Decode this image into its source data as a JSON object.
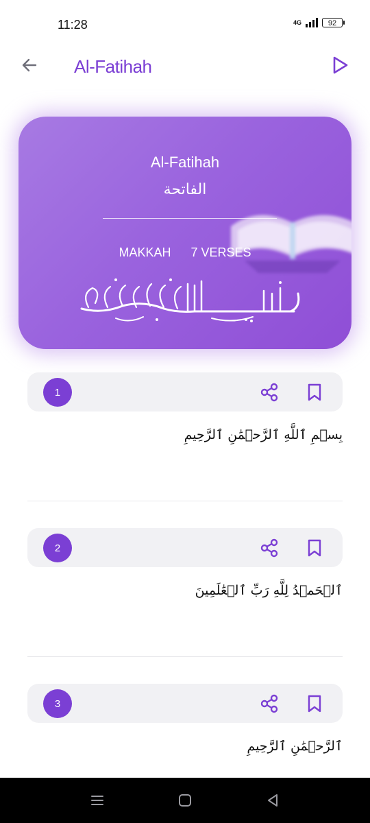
{
  "status_bar": {
    "time": "11:28",
    "network": "4G",
    "battery": "92"
  },
  "app_bar": {
    "title": "Al-Fatihah"
  },
  "surah": {
    "name": "Al-Fatihah",
    "name_arabic": "الفاتحة",
    "revelation": "MAKKAH",
    "verses_label": "7 VERSES"
  },
  "verses": [
    {
      "number": "1",
      "arabic": "بِسۡمِ ٱللَّهِ ٱلرَّحۡمَٰنِ ٱلرَّحِيمِ"
    },
    {
      "number": "2",
      "arabic": "ٱلۡحَمۡدُ لِلَّهِ رَبِّ ٱلۡعَٰلَمِينَ"
    },
    {
      "number": "3",
      "arabic": "ٱلرَّحۡمَٰنِ ٱلرَّحِيمِ"
    }
  ],
  "colors": {
    "accent": "#7b3fd4",
    "card_start": "#a77ae3",
    "card_end": "#8f4ed6",
    "verse_bar": "#f1f1f4"
  },
  "icons": {
    "back": "arrow-left-icon",
    "play": "play-icon",
    "share": "share-icon",
    "bookmark": "bookmark-icon",
    "nav_recents": "menu-lines-icon",
    "nav_home": "square-icon",
    "nav_back": "triangle-back-icon"
  }
}
